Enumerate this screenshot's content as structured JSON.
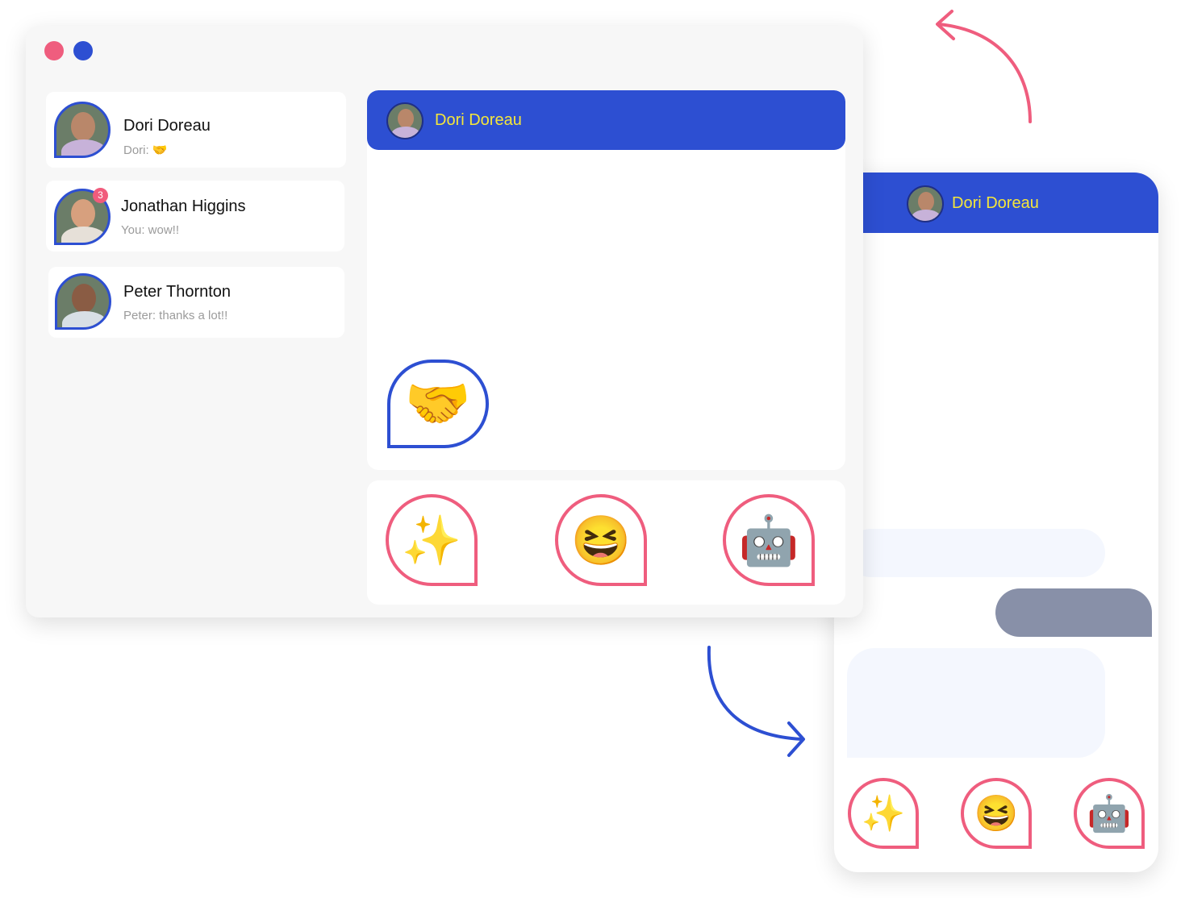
{
  "colors": {
    "accent_blue": "#2d4fd2",
    "accent_pink": "#ef5d7e",
    "header_text": "#f5e63a",
    "badge": "#f15b7c",
    "bubble_light": "#f4f7fe",
    "bubble_dark": "#8890a8"
  },
  "desktop": {
    "window_controls": [
      "close",
      "minimize"
    ],
    "conversations": [
      {
        "name": "Dori Doreau",
        "preview": "Dori:",
        "preview_emoji": "🤝",
        "unread": null
      },
      {
        "name": "Jonathan Higgins",
        "preview": "You: wow!!",
        "preview_emoji": "",
        "unread": "3"
      },
      {
        "name": "Peter Thornton",
        "preview": "Peter: thanks a lot!!",
        "preview_emoji": "",
        "unread": null
      }
    ],
    "chat": {
      "contact_name": "Dori Doreau",
      "sticker": "🤝"
    },
    "stickers": [
      "✨",
      "😆",
      "🤖"
    ]
  },
  "mobile": {
    "chat": {
      "contact_name": "Dori Doreau"
    },
    "stickers": [
      "✨",
      "😆",
      "🤖"
    ]
  }
}
